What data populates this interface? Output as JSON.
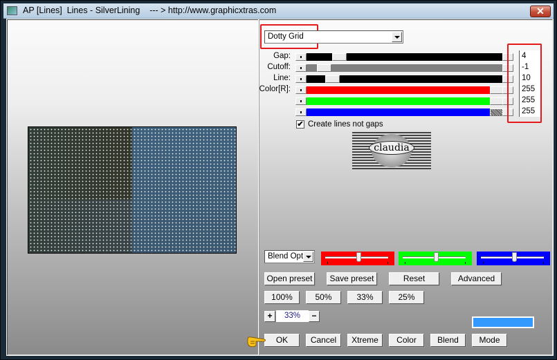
{
  "window": {
    "title": "AP [Lines]  Lines - SilverLining    --- > http://www.graphicxtras.com",
    "close_label": "✕"
  },
  "preview": {
    "description": "Dotty grid preview image",
    "colors": {
      "left": "#33392f",
      "right": "#3d5d78",
      "dots": "#f4f4f4"
    }
  },
  "preset_select": {
    "value": "Dotty Grid"
  },
  "controls": [
    {
      "label": "Gap:",
      "value": "4",
      "track_color": "#000000"
    },
    {
      "label": "Cutoff:",
      "value": "-1",
      "track_color": "#808080"
    },
    {
      "label": "Line:",
      "value": "10",
      "track_color": "#000000"
    },
    {
      "label": "Color[R]:",
      "value": "255",
      "track_color": "#ff0000"
    },
    {
      "label": "",
      "value": "255",
      "track_color": "#00ff00"
    },
    {
      "label": "",
      "value": "255",
      "track_color": "#0000ff"
    }
  ],
  "create_lines_checkbox": {
    "label": "Create lines not gaps",
    "checked": true,
    "mark": "✔"
  },
  "logo": {
    "text": "claudia"
  },
  "blend_select": {
    "value": "Blend Optio"
  },
  "blend_sliders": [
    {
      "name": "red",
      "color": "#ff0000",
      "position": 0.53
    },
    {
      "name": "green",
      "color": "#00ff00",
      "position": 0.53
    },
    {
      "name": "blue",
      "color": "#0000ff",
      "position": 0.53
    }
  ],
  "buttons": {
    "open_preset": "Open preset",
    "save_preset": "Save preset",
    "reset": "Reset",
    "advanced": "Advanced",
    "zoom_100": "100%",
    "zoom_50": "50%",
    "zoom_33": "33%",
    "zoom_25": "25%",
    "zoom_plus": "+",
    "zoom_minus": "−",
    "ok": "OK",
    "cancel": "Cancel",
    "xtreme": "Xtreme",
    "color": "Color",
    "blend": "Blend",
    "mode": "Mode"
  },
  "zoom_level": "33%",
  "color_swatch": "#3399ff"
}
